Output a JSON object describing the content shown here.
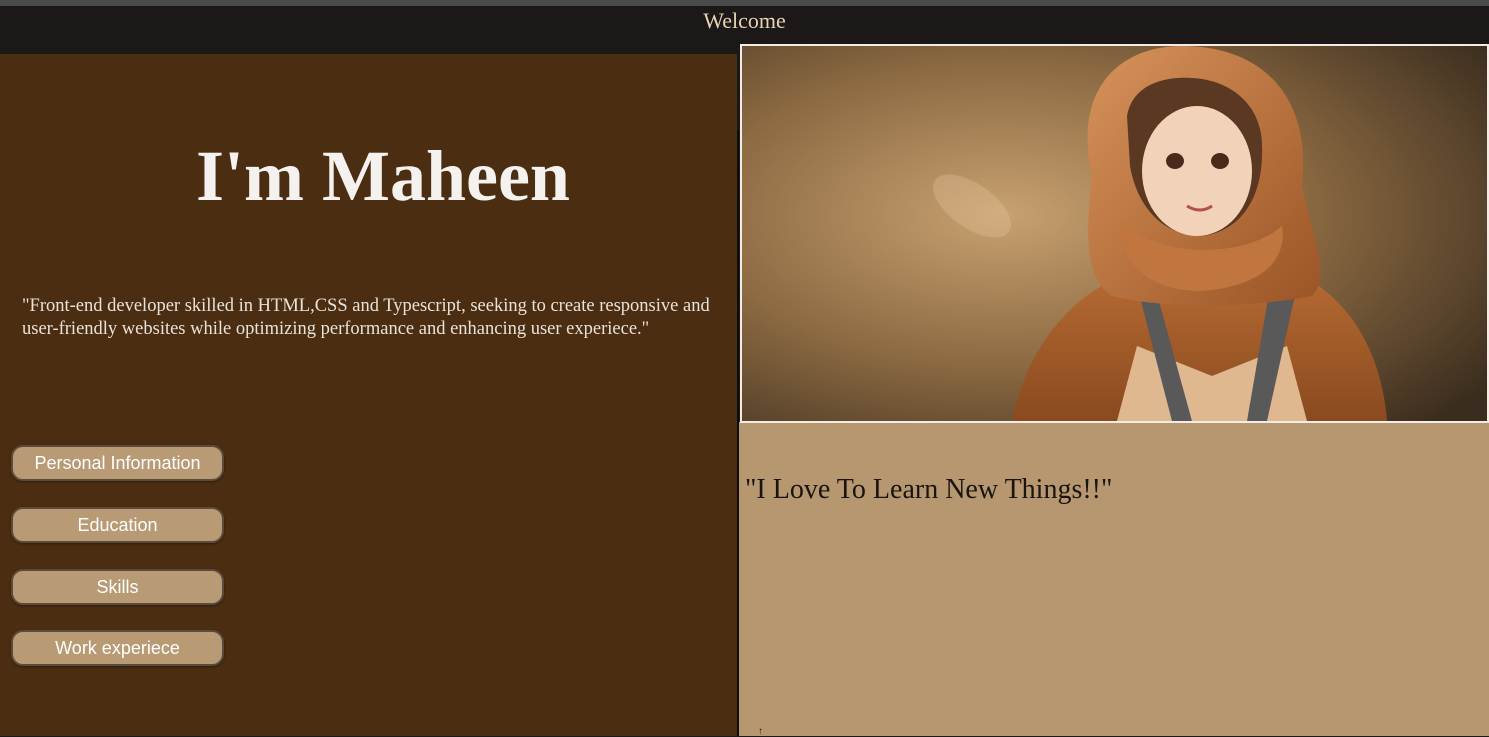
{
  "header": {
    "title": "Welcome"
  },
  "intro": {
    "heading": "I'm Maheen",
    "bio": "\"Front-end developer skilled in HTML,CSS and Typescript, seeking to create responsive and user-friendly websites while optimizing performance and enhancing user experiece.\""
  },
  "nav": {
    "buttons": [
      {
        "label": "Personal Information"
      },
      {
        "label": "Education"
      },
      {
        "label": "Skills"
      },
      {
        "label": "Work experiece"
      }
    ]
  },
  "hero": {
    "image_icon": "portrait-illustration"
  },
  "right": {
    "quote": "\"I Love To Learn New Things!!\""
  },
  "colors": {
    "left_bg": "#4b2e11",
    "right_bg": "#b6976f",
    "header_bg": "#1b1817",
    "button_bg": "#b89a74"
  }
}
